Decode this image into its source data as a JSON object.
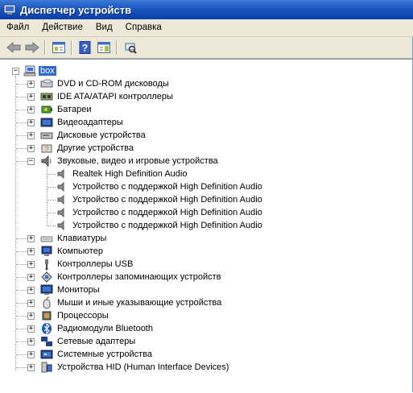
{
  "window": {
    "title": "Диспетчер устройств"
  },
  "menu": [
    "Файл",
    "Действие",
    "Вид",
    "Справка"
  ],
  "toolbar": {
    "buttons": [
      "back-arrow-icon",
      "forward-arrow-icon",
      "properties-icon",
      "help-icon",
      "view-icon",
      "scan-hardware-icon"
    ]
  },
  "tree": {
    "root": "box",
    "categories": [
      {
        "label": "DVD и CD-ROM дисководы",
        "icon": "dvd-drive-icon"
      },
      {
        "label": "IDE ATA/ATAPI контроллеры",
        "icon": "ide-controller-icon"
      },
      {
        "label": "Батареи",
        "icon": "battery-icon"
      },
      {
        "label": "Видеоадаптеры",
        "icon": "display-adapter-icon"
      },
      {
        "label": "Дисковые устройства",
        "icon": "disk-drive-icon"
      },
      {
        "label": "Другие устройства",
        "icon": "other-devices-icon"
      },
      {
        "label": "Звуковые, видео и игровые устройства",
        "icon": "speaker-icon",
        "expanded": true,
        "children": [
          "Realtek High Definition Audio",
          "Устройство с поддержкой High Definition Audio",
          "Устройство с поддержкой High Definition Audio",
          "Устройство с поддержкой High Definition Audio",
          "Устройство с поддержкой High Definition Audio"
        ]
      },
      {
        "label": "Клавиатуры",
        "icon": "keyboard-icon"
      },
      {
        "label": "Компьютер",
        "icon": "computer-icon"
      },
      {
        "label": "Контроллеры USB",
        "icon": "usb-icon"
      },
      {
        "label": "Контроллеры запоминающих устройств",
        "icon": "storage-controller-icon"
      },
      {
        "label": "Мониторы",
        "icon": "monitor-icon"
      },
      {
        "label": "Мыши и иные указывающие устройства",
        "icon": "mouse-icon"
      },
      {
        "label": "Процессоры",
        "icon": "processor-icon"
      },
      {
        "label": "Радиомодули Bluetooth",
        "icon": "bluetooth-icon"
      },
      {
        "label": "Сетевые адаптеры",
        "icon": "network-adapter-icon"
      },
      {
        "label": "Системные устройства",
        "icon": "system-devices-icon"
      },
      {
        "label": "Устройства HID (Human Interface Devices)",
        "icon": "hid-icon"
      }
    ]
  },
  "colors": {
    "titlebar": "#0a3fa8",
    "selection": "#316ac5",
    "chrome": "#ece9d8"
  }
}
